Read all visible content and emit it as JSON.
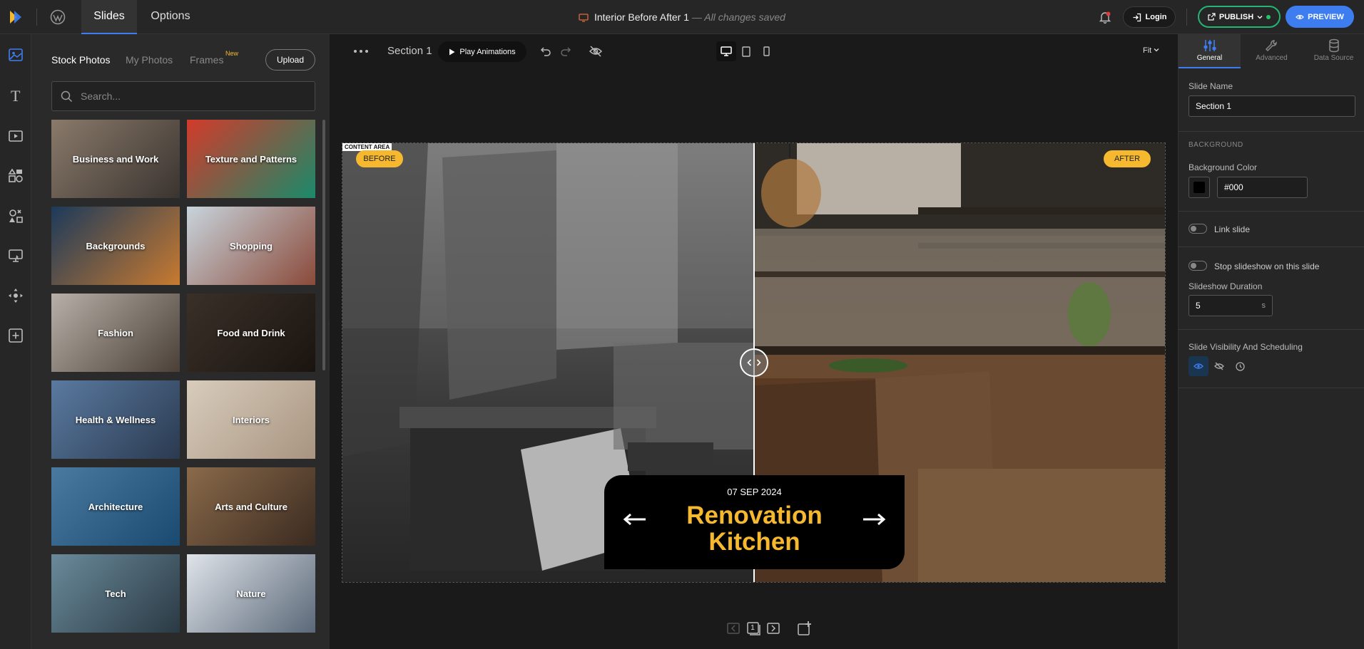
{
  "header": {
    "tabs": [
      {
        "label": "Slides"
      },
      {
        "label": "Options"
      }
    ],
    "doc_title": "Interior Before After 1",
    "save_status": "All changes saved",
    "login_label": "Login",
    "publish_label": "PUBLISH",
    "preview_label": "PREVIEW"
  },
  "rail": {
    "icons": [
      "image-icon",
      "text-icon",
      "video-icon",
      "shapes-icon",
      "elements-icon",
      "widgets-icon",
      "move-icon",
      "add-icon"
    ]
  },
  "library": {
    "tabs": [
      {
        "label": "Stock Photos"
      },
      {
        "label": "My Photos"
      },
      {
        "label": "Frames"
      }
    ],
    "new_badge": "New",
    "upload_label": "Upload",
    "search_placeholder": "Search...",
    "categories": [
      {
        "label": "Business and Work",
        "colors": [
          "#8a7a6a",
          "#3a3430"
        ]
      },
      {
        "label": "Texture and Patterns",
        "colors": [
          "#d23a2a",
          "#1a8a6a"
        ]
      },
      {
        "label": "Backgrounds",
        "colors": [
          "#1c3a5a",
          "#c87a30"
        ]
      },
      {
        "label": "Shopping",
        "colors": [
          "#c8d4dc",
          "#8a4a3a"
        ]
      },
      {
        "label": "Fashion",
        "colors": [
          "#b8b0a8",
          "#4a4038"
        ]
      },
      {
        "label": "Food and Drink",
        "colors": [
          "#3a3028",
          "#1a1410"
        ]
      },
      {
        "label": "Health & Wellness",
        "colors": [
          "#5a7aa0",
          "#2a3a50"
        ]
      },
      {
        "label": "Interiors",
        "colors": [
          "#d8ccbc",
          "#a89480"
        ]
      },
      {
        "label": "Architecture",
        "colors": [
          "#4a7aa0",
          "#1a4a70"
        ]
      },
      {
        "label": "Arts and Culture",
        "colors": [
          "#8a6a4a",
          "#3a2a20"
        ]
      },
      {
        "label": "Tech",
        "colors": [
          "#6a8a9a",
          "#2a3a44"
        ]
      },
      {
        "label": "Nature",
        "colors": [
          "#e0e4ea",
          "#5a6878"
        ]
      }
    ]
  },
  "canvas": {
    "section_label": "Section 1",
    "play_label": "Play Animations",
    "zoom_label": "Fit",
    "content_area_tag": "CONTENT AREA",
    "before_label": "BEFORE",
    "after_label": "AFTER",
    "caption_date": "07 SEP 2024",
    "caption_title": "Renovation Kitchen",
    "slide_count": "1"
  },
  "props": {
    "tabs": [
      {
        "label": "General"
      },
      {
        "label": "Advanced"
      },
      {
        "label": "Data Source"
      }
    ],
    "slide_name_label": "Slide Name",
    "slide_name_value": "Section 1",
    "background_section": "BACKGROUND",
    "background_color_label": "Background Color",
    "background_color_value": "#000",
    "link_slide_label": "Link slide",
    "stop_slideshow_label": "Stop slideshow on this slide",
    "duration_label": "Slideshow Duration",
    "duration_value": "5",
    "duration_unit": "s",
    "visibility_label": "Slide Visibility And Scheduling"
  },
  "colors": {
    "accent": "#3d7df0",
    "publish": "#22b573",
    "highlight": "#f5b82e"
  }
}
